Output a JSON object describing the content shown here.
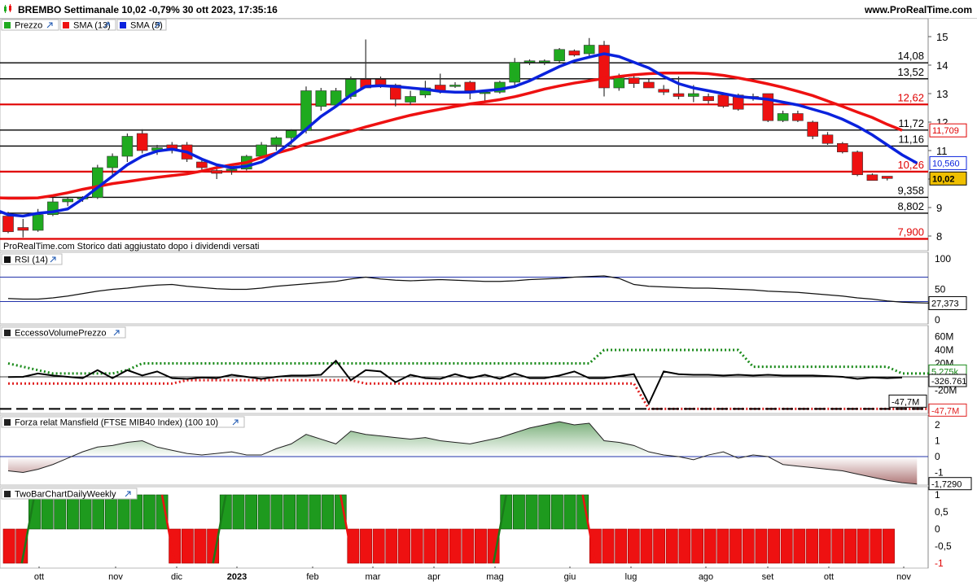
{
  "header": {
    "title": "BREMBO Settimanale 10,02 -0,79% 30 ott 2023, 17:35:16",
    "site": "www.ProRealTime.com"
  },
  "colors": {
    "up": "#1faa1f",
    "down": "#ee1111",
    "sma13": "#ee1111",
    "sma5": "#0a22dd",
    "accent": "#f0c000"
  },
  "panels": {
    "price": {
      "legend": [
        "Prezzo",
        "SMA (13)",
        "SMA (5)"
      ],
      "footnote": "ProRealTime.com  Storico dati aggiustato dopo i dividendi versati",
      "axis_ticks": [
        "15",
        "14",
        "13",
        "12",
        "11",
        "10",
        "9",
        "8"
      ],
      "levels": [
        {
          "label": "14,08",
          "value": 14.08,
          "color": "#000000"
        },
        {
          "label": "13,52",
          "value": 13.52,
          "color": "#000000"
        },
        {
          "label": "12,62",
          "value": 12.62,
          "color": "#e00000"
        },
        {
          "label": "11,72",
          "value": 11.72,
          "color": "#000000"
        },
        {
          "label": "11,16",
          "value": 11.16,
          "color": "#000000"
        },
        {
          "label": "10,26",
          "value": 10.26,
          "color": "#e00000"
        },
        {
          "label": "9,358",
          "value": 9.358,
          "color": "#000000"
        },
        {
          "label": "8,802",
          "value": 8.802,
          "color": "#000000"
        },
        {
          "label": "7,900",
          "value": 7.9,
          "color": "#e00000"
        }
      ],
      "badges": [
        {
          "label": "11,709",
          "value": 11.709,
          "color": "#e00000"
        },
        {
          "label": "10,560",
          "value": 10.56,
          "color": "#0a22dd"
        },
        {
          "label": "10,02",
          "value": 10.02,
          "color": "#000000"
        }
      ]
    },
    "rsi": {
      "legend": "RSI (14)",
      "axis_ticks": [
        "100",
        "50",
        "0"
      ],
      "last": "27,373"
    },
    "volume": {
      "legend": "EccessoVolumePrezzo",
      "axis_ticks": [
        "60M",
        "40M",
        "20M",
        "-20M"
      ],
      "badges": [
        "5,275k",
        "-326.761",
        "-47,7M",
        "-47,7M"
      ]
    },
    "mansfield": {
      "legend": "Forza relat Mansfield (FTSE MIB40 Index) (100 10)",
      "axis_ticks": [
        "2",
        "1",
        "0",
        "-1"
      ],
      "last": "-1,7290"
    },
    "twobar": {
      "legend": "TwoBarChartDailyWeekly",
      "axis_ticks": [
        "1",
        "0,5",
        "0",
        "-0,5",
        "-1"
      ]
    }
  },
  "x_axis": [
    "ott",
    "nov",
    "dic",
    "2023",
    "feb",
    "mar",
    "apr",
    "mag",
    "giu",
    "lug",
    "ago",
    "set",
    "ott",
    "nov"
  ],
  "chart_data": {
    "type": "candlestick",
    "x_unit": "week",
    "x_start": "2022-09-26",
    "ylim": [
      7.7,
      15.4
    ],
    "candles": [
      {
        "o": 8.7,
        "h": 8.85,
        "l": 8.1,
        "c": 8.15
      },
      {
        "o": 8.3,
        "h": 8.6,
        "l": 7.95,
        "c": 8.2
      },
      {
        "o": 8.2,
        "h": 8.95,
        "l": 8.15,
        "c": 8.75
      },
      {
        "o": 8.75,
        "h": 9.35,
        "l": 8.7,
        "c": 9.2
      },
      {
        "o": 9.2,
        "h": 9.35,
        "l": 9.05,
        "c": 9.3
      },
      {
        "o": 9.3,
        "h": 9.4,
        "l": 9.2,
        "c": 9.35
      },
      {
        "o": 9.35,
        "h": 10.5,
        "l": 9.3,
        "c": 10.4
      },
      {
        "o": 10.4,
        "h": 10.9,
        "l": 10.1,
        "c": 10.8
      },
      {
        "o": 10.8,
        "h": 11.6,
        "l": 10.6,
        "c": 11.5
      },
      {
        "o": 11.6,
        "h": 11.75,
        "l": 10.9,
        "c": 11.0
      },
      {
        "o": 11.0,
        "h": 11.2,
        "l": 10.85,
        "c": 11.1
      },
      {
        "o": 11.2,
        "h": 11.3,
        "l": 10.9,
        "c": 11.0
      },
      {
        "o": 11.2,
        "h": 11.3,
        "l": 10.6,
        "c": 10.7
      },
      {
        "o": 10.6,
        "h": 10.7,
        "l": 10.3,
        "c": 10.4
      },
      {
        "o": 10.3,
        "h": 10.5,
        "l": 10.0,
        "c": 10.2
      },
      {
        "o": 10.3,
        "h": 10.45,
        "l": 10.15,
        "c": 10.35
      },
      {
        "o": 10.35,
        "h": 10.85,
        "l": 10.3,
        "c": 10.8
      },
      {
        "o": 10.8,
        "h": 11.3,
        "l": 10.75,
        "c": 11.2
      },
      {
        "o": 11.2,
        "h": 11.5,
        "l": 11.0,
        "c": 11.45
      },
      {
        "o": 11.45,
        "h": 11.75,
        "l": 11.2,
        "c": 11.7
      },
      {
        "o": 11.7,
        "h": 13.25,
        "l": 11.6,
        "c": 13.1
      },
      {
        "o": 12.55,
        "h": 13.2,
        "l": 12.4,
        "c": 13.1
      },
      {
        "o": 12.6,
        "h": 13.2,
        "l": 12.55,
        "c": 13.1
      },
      {
        "o": 12.9,
        "h": 13.6,
        "l": 12.8,
        "c": 13.5
      },
      {
        "o": 13.5,
        "h": 14.9,
        "l": 13.2,
        "c": 13.2
      },
      {
        "o": 13.5,
        "h": 13.6,
        "l": 13.2,
        "c": 13.3
      },
      {
        "o": 13.3,
        "h": 13.35,
        "l": 12.55,
        "c": 12.8
      },
      {
        "o": 12.7,
        "h": 13.1,
        "l": 12.6,
        "c": 12.9
      },
      {
        "o": 12.95,
        "h": 13.45,
        "l": 12.85,
        "c": 13.2
      },
      {
        "o": 13.3,
        "h": 13.7,
        "l": 13.0,
        "c": 13.1
      },
      {
        "o": 13.25,
        "h": 13.4,
        "l": 13.2,
        "c": 13.3
      },
      {
        "o": 13.4,
        "h": 13.45,
        "l": 12.8,
        "c": 13.1
      },
      {
        "o": 13.0,
        "h": 13.1,
        "l": 12.7,
        "c": 13.05
      },
      {
        "o": 13.05,
        "h": 13.45,
        "l": 13.0,
        "c": 13.4
      },
      {
        "o": 13.4,
        "h": 14.25,
        "l": 13.3,
        "c": 14.1
      },
      {
        "o": 14.1,
        "h": 14.2,
        "l": 14.0,
        "c": 14.15
      },
      {
        "o": 14.1,
        "h": 14.2,
        "l": 14.0,
        "c": 14.15
      },
      {
        "o": 14.15,
        "h": 14.6,
        "l": 14.1,
        "c": 14.55
      },
      {
        "o": 14.5,
        "h": 14.55,
        "l": 14.3,
        "c": 14.35
      },
      {
        "o": 14.4,
        "h": 14.95,
        "l": 14.3,
        "c": 14.7
      },
      {
        "o": 14.7,
        "h": 14.85,
        "l": 12.9,
        "c": 13.2
      },
      {
        "o": 13.2,
        "h": 13.7,
        "l": 13.1,
        "c": 13.55
      },
      {
        "o": 13.55,
        "h": 13.7,
        "l": 13.2,
        "c": 13.35
      },
      {
        "o": 13.4,
        "h": 13.5,
        "l": 13.2,
        "c": 13.2
      },
      {
        "o": 13.15,
        "h": 13.3,
        "l": 12.95,
        "c": 13.05
      },
      {
        "o": 13.0,
        "h": 13.6,
        "l": 12.8,
        "c": 12.9
      },
      {
        "o": 12.9,
        "h": 13.3,
        "l": 12.7,
        "c": 13.0
      },
      {
        "o": 12.9,
        "h": 13.0,
        "l": 12.65,
        "c": 12.75
      },
      {
        "o": 12.95,
        "h": 13.0,
        "l": 12.5,
        "c": 12.55
      },
      {
        "o": 12.95,
        "h": 13.0,
        "l": 12.4,
        "c": 12.45
      },
      {
        "o": 12.9,
        "h": 13.0,
        "l": 12.75,
        "c": 12.85
      },
      {
        "o": 13.0,
        "h": 13.0,
        "l": 12.0,
        "c": 12.05
      },
      {
        "o": 12.05,
        "h": 12.4,
        "l": 12.0,
        "c": 12.3
      },
      {
        "o": 12.3,
        "h": 12.4,
        "l": 12.0,
        "c": 12.05
      },
      {
        "o": 12.0,
        "h": 12.05,
        "l": 11.4,
        "c": 11.5
      },
      {
        "o": 11.55,
        "h": 11.65,
        "l": 11.2,
        "c": 11.25
      },
      {
        "o": 11.25,
        "h": 11.3,
        "l": 10.9,
        "c": 10.95
      },
      {
        "o": 10.95,
        "h": 11.0,
        "l": 10.1,
        "c": 10.15
      },
      {
        "o": 10.15,
        "h": 10.2,
        "l": 9.95,
        "c": 9.95
      },
      {
        "o": 10.1,
        "h": 10.1,
        "l": 9.95,
        "c": 10.02
      }
    ],
    "sma13": [
      9.45,
      9.4,
      9.35,
      9.33,
      9.33,
      9.34,
      9.42,
      9.52,
      9.64,
      9.74,
      9.84,
      9.91,
      9.99,
      10.06,
      10.12,
      10.18,
      10.28,
      10.4,
      10.5,
      10.58,
      10.76,
      10.91,
      11.05,
      11.23,
      11.37,
      11.53,
      11.68,
      11.83,
      11.97,
      12.11,
      12.24,
      12.35,
      12.45,
      12.55,
      12.64,
      12.71,
      12.79,
      12.89,
      13.02,
      13.16,
      13.27,
      13.37,
      13.45,
      13.53,
      13.6,
      13.66,
      13.7,
      13.72,
      13.72,
      13.72,
      13.7,
      13.64,
      13.55,
      13.45,
      13.34,
      13.22,
      13.08,
      12.93,
      12.74,
      12.55,
      12.35,
      12.16,
      11.92,
      11.709
    ],
    "sma5": [
      8.95,
      8.75,
      8.7,
      8.8,
      8.85,
      8.95,
      9.3,
      9.7,
      10.1,
      10.5,
      10.8,
      10.98,
      11.05,
      10.95,
      10.7,
      10.5,
      10.4,
      10.45,
      10.6,
      10.9,
      11.3,
      11.75,
      12.2,
      12.55,
      12.95,
      13.25,
      13.28,
      13.25,
      13.2,
      13.15,
      13.08,
      13.05,
      13.05,
      13.1,
      13.15,
      13.25,
      13.45,
      13.7,
      13.95,
      14.15,
      14.28,
      14.4,
      14.3,
      14.1,
      13.9,
      13.6,
      13.35,
      13.2,
      13.1,
      13.0,
      12.9,
      12.85,
      12.8,
      12.7,
      12.6,
      12.45,
      12.3,
      12.1,
      11.85,
      11.55,
      11.2,
      10.85,
      10.56
    ],
    "rsi": [
      35,
      34,
      34,
      36,
      39,
      43,
      47,
      50,
      52,
      55,
      57,
      58,
      55,
      53,
      51,
      50,
      50,
      52,
      55,
      57,
      59,
      61,
      63,
      67,
      70,
      67,
      65,
      64,
      65,
      66,
      65,
      64,
      63,
      63,
      64,
      66,
      67,
      68,
      70,
      71,
      72,
      68,
      58,
      55,
      54,
      53,
      52,
      52,
      51,
      50,
      49,
      47,
      46,
      45,
      43,
      41,
      39,
      36,
      34,
      31,
      29,
      28,
      27.373
    ],
    "volume_line": [
      -0.3,
      0,
      5,
      2,
      0,
      -2,
      10,
      -2,
      10,
      2,
      8,
      -2,
      -3,
      -1,
      -2,
      3,
      0,
      -3,
      0,
      2,
      2,
      3,
      24,
      -5,
      10,
      8,
      -8,
      3,
      -2,
      -3,
      4,
      -2,
      3,
      -3,
      5,
      -2,
      -2,
      2,
      8,
      -2,
      -2,
      1,
      4,
      -40,
      8,
      4,
      3,
      3,
      2,
      3,
      2,
      3,
      2,
      2,
      2,
      1,
      0,
      -3,
      -1,
      -2,
      -1
    ],
    "volume_upper_band": [
      20,
      15,
      10,
      5,
      5,
      5,
      5,
      5,
      10,
      20,
      20,
      20,
      20,
      20,
      20,
      20,
      20,
      20,
      20,
      20,
      20,
      20,
      20,
      20,
      20,
      20,
      20,
      20,
      20,
      20,
      20,
      20,
      20,
      20,
      20,
      20,
      20,
      20,
      20,
      20,
      40,
      40,
      40,
      40,
      40,
      40,
      40,
      40,
      40,
      40,
      15,
      15,
      15,
      15,
      15,
      15,
      15,
      15,
      15,
      15,
      5,
      5,
      5,
      5
    ],
    "volume_lower_band": [
      -10,
      -10,
      -10,
      -10,
      -10,
      -10,
      -10,
      -10,
      -10,
      -10,
      -10,
      -10,
      -5,
      -5,
      -5,
      -5,
      -5,
      -5,
      -5,
      -5,
      -5,
      -5,
      -5,
      -5,
      -10,
      -10,
      -10,
      -10,
      -10,
      -10,
      -10,
      -10,
      -10,
      -10,
      -10,
      -10,
      -10,
      -10,
      -10,
      -10,
      -10,
      -10,
      -10,
      -47.7,
      -47.7,
      -47.7,
      -47.7,
      -47.7,
      -47.7,
      -47.7,
      -47.7,
      -47.7,
      -47.7,
      -47.7,
      -47.7,
      -47.7,
      -47.7,
      -47.7,
      -47.7,
      -47.7,
      -47.7,
      -47.7,
      -47.7,
      -47.7
    ],
    "volume_baseline": -47.7,
    "mansfield": [
      -0.9,
      -1.0,
      -0.8,
      -0.5,
      -0.1,
      0.3,
      0.6,
      0.7,
      0.9,
      1.0,
      0.6,
      0.4,
      0.2,
      0.1,
      0.2,
      0.3,
      0.1,
      0.1,
      0.5,
      0.8,
      1.4,
      1.1,
      0.8,
      1.6,
      1.4,
      1.3,
      1.2,
      1.1,
      1.2,
      1.0,
      0.9,
      0.8,
      1.0,
      1.2,
      1.5,
      1.8,
      2.0,
      2.2,
      2.0,
      2.1,
      1.0,
      0.9,
      0.7,
      0.3,
      0.1,
      0,
      -0.2,
      0.1,
      0.3,
      -0.1,
      0.1,
      0,
      -0.5,
      -0.6,
      -0.7,
      -0.8,
      -0.9,
      -1.1,
      -1.3,
      -1.5,
      -1.65,
      -1.729
    ],
    "twobar": [
      -1,
      -1,
      1,
      1,
      1,
      1,
      1,
      1,
      1,
      1,
      1,
      1,
      1,
      -1,
      -1,
      -1,
      -1,
      1,
      1,
      1,
      1,
      1,
      1,
      1,
      1,
      1,
      1,
      -1,
      -1,
      -1,
      -1,
      -1,
      -1,
      -1,
      -1,
      -1,
      -1,
      -1,
      -1,
      1,
      1,
      1,
      1,
      1,
      1,
      1,
      -1,
      -1,
      -1,
      -1,
      -1,
      -1,
      -1,
      -1,
      -1,
      -1,
      -1,
      -1,
      -1,
      -1,
      -1,
      -1,
      -1,
      -1,
      -1,
      -1,
      -1,
      -1,
      -1,
      -1
    ]
  }
}
